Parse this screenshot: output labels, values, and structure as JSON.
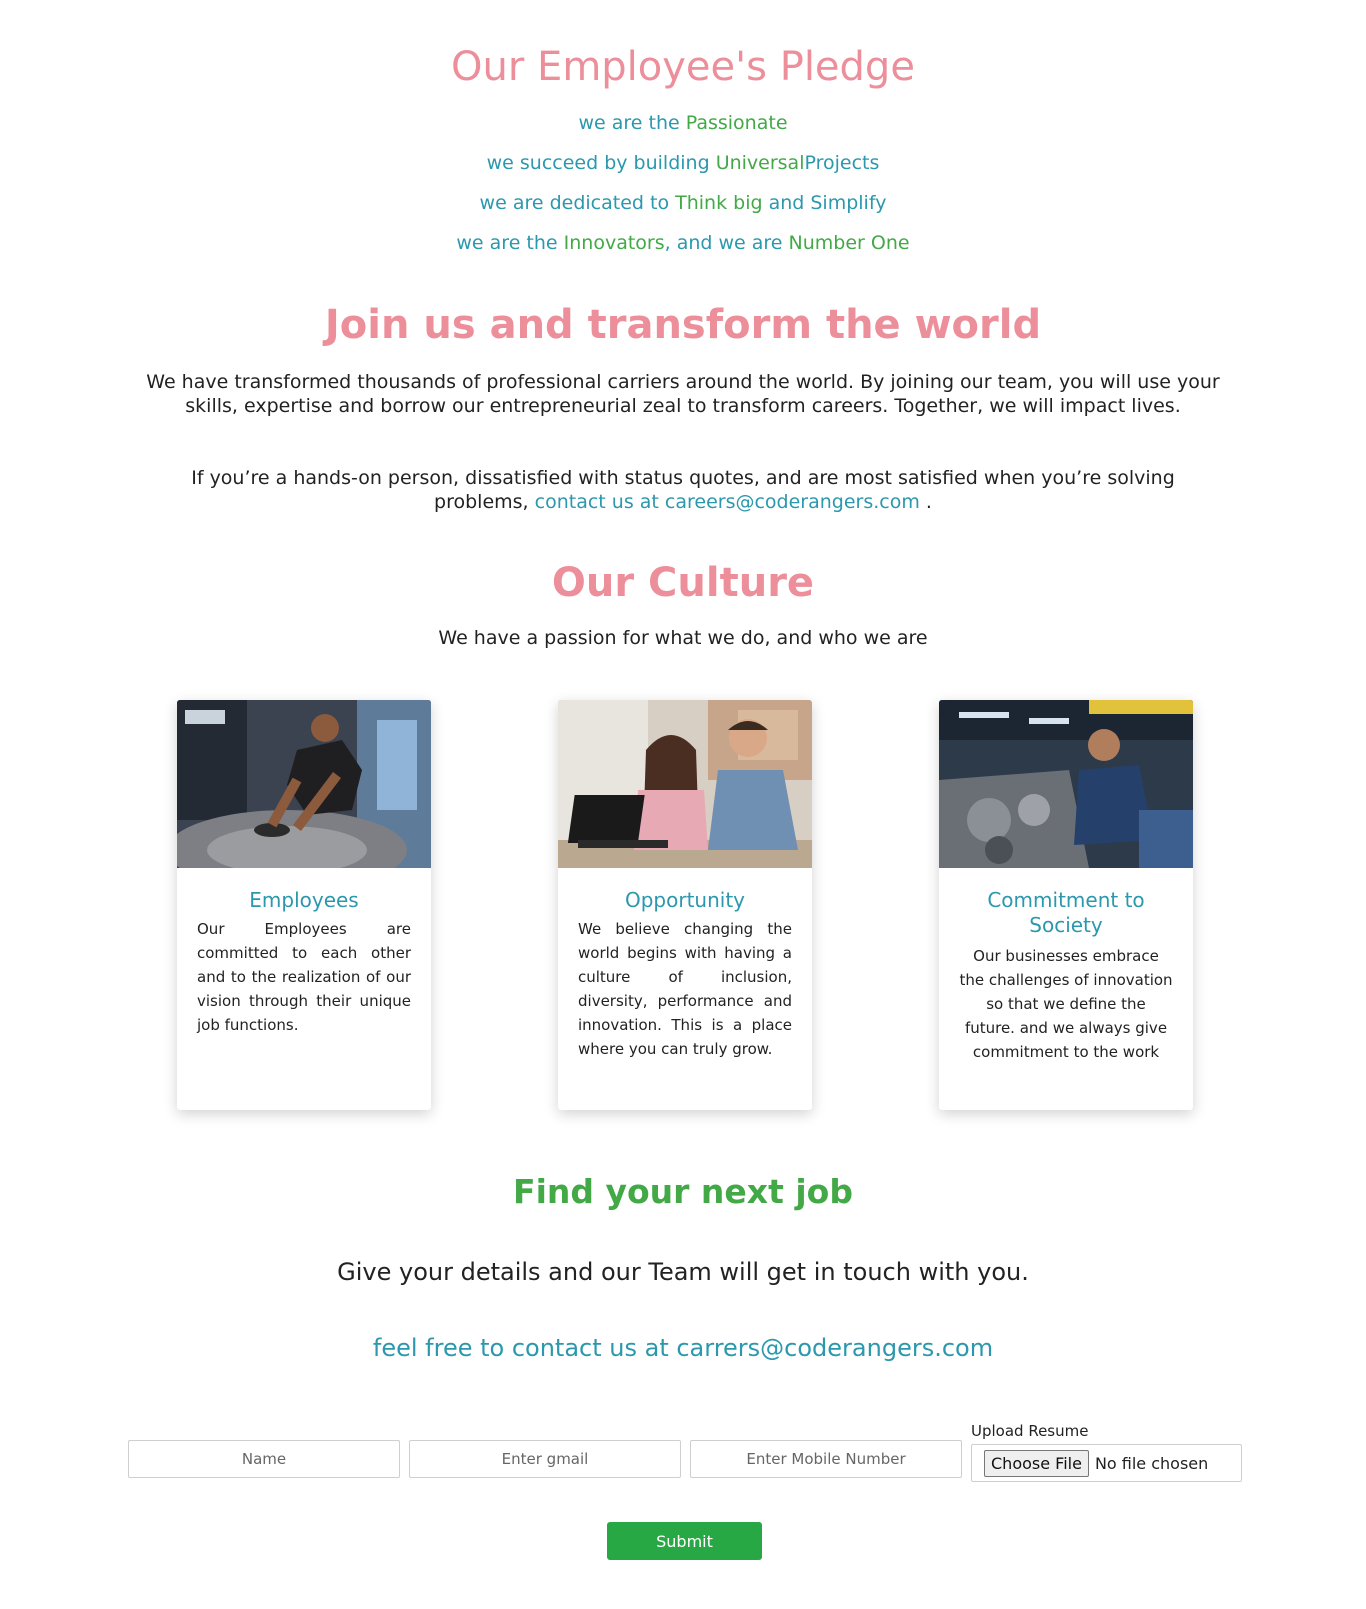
{
  "pledge": {
    "title": "Our Employee's Pledge",
    "lines": [
      {
        "a": "we are the ",
        "b": "Passionate",
        "c": "",
        "d": "",
        "e": ""
      },
      {
        "a": "we succeed by building ",
        "b": "Universal",
        "c": "Projects",
        "d": "",
        "e": ""
      },
      {
        "a": "we are dedicated to ",
        "b": "Think big",
        "c": " and ",
        "d": "Simplify",
        "e": ""
      },
      {
        "a": "we are the ",
        "b": "Innovators",
        "c": ", and we are ",
        "d": "Number One",
        "e": ""
      }
    ]
  },
  "join": {
    "title": "Join us and transform the world",
    "p1": "We have transformed thousands of professional carriers around the world. By joining our team, you will use your skills, expertise and borrow our entrepreneurial zeal to transform careers. Together, we will impact lives.",
    "p2_text": "If you’re a hands-on person, dissatisfied with status quotes, and are most satisfied when you’re solving problems, ",
    "p2_link": "contact us at careers@coderangers.com",
    "p2_end": " ."
  },
  "culture": {
    "title": "Our Culture",
    "subtitle": "We have a passion for what we do, and who we are",
    "cards": [
      {
        "title": "Employees",
        "text": "Our Employees are committed to each other and to the realization of our vision through their unique job functions.",
        "image": "employee-machining-photo"
      },
      {
        "title": "Opportunity",
        "text": "We believe changing the world begins with having a culture of inclusion, diversity, performance and innovation. This is a place where you can truly grow.",
        "image": "colleagues-laptop-photo"
      },
      {
        "title": "Commitment to Society",
        "text": "Our businesses embrace the challenges of innovation so that we define the future. and we always give commitment to the work",
        "image": "engine-technician-photo"
      }
    ]
  },
  "job": {
    "title": "Find your next job",
    "subtitle": "Give your details and our Team will get in touch with you.",
    "contact": "feel free to contact us at carrers@coderangers.com"
  },
  "form": {
    "name_placeholder": "Name",
    "email_placeholder": "Enter gmail",
    "mobile_placeholder": "Enter Mobile Number",
    "upload_label": "Upload Resume",
    "choose_file": "Choose File",
    "no_file": "No file chosen",
    "submit": "Submit"
  },
  "colors": {
    "heading_pink": "#ec8f9a",
    "teal": "#2b98ad",
    "green": "#43a947",
    "submit_green": "#28a745"
  }
}
